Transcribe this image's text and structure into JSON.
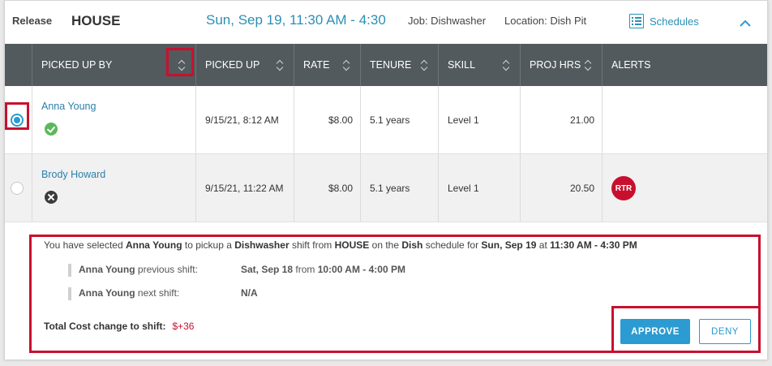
{
  "header": {
    "release_label": "Release",
    "location_name": "HOUSE",
    "date_range": "Sun, Sep 19, 11:30 AM - 4:30 PM",
    "job": "Job: Dishwasher",
    "location": "Location: Dish Pit",
    "schedules_label": "Schedules"
  },
  "table": {
    "columns": [
      "PICKED UP BY",
      "PICKED UP",
      "RATE",
      "TENURE",
      "SKILL",
      "PROJ HRS",
      "ALERTS"
    ],
    "rows": [
      {
        "name": "Anna Young",
        "status": "approved-check",
        "picked_up": "9/15/21, 8:12 AM",
        "rate": "$8.00",
        "tenure": "5.1 years",
        "skill": "Level 1",
        "proj_hrs": "21.00",
        "alert": "",
        "selected": true
      },
      {
        "name": "Brody Howard",
        "status": "rejected-x",
        "picked_up": "9/15/21, 11:22 AM",
        "rate": "$8.00",
        "tenure": "5.1 years",
        "skill": "Level 1",
        "proj_hrs": "20.50",
        "alert": "RTR",
        "selected": false
      }
    ]
  },
  "summary": {
    "sentence": {
      "p1": "You have selected ",
      "employee": "Anna Young",
      "p2": " to pickup a ",
      "job": "Dishwasher",
      "p3": " shift from ",
      "location": "HOUSE",
      "p4": " on the ",
      "schedule": "Dish",
      "p5": " schedule for ",
      "date": "Sun, Sep 19",
      "p6": " at ",
      "time": "11:30 AM - 4:30 PM"
    },
    "previous_shift": {
      "employee": "Anna Young",
      "label": " previous shift:",
      "day": "Sat, Sep 18",
      "from_word": " from ",
      "time": "10:00 AM - 4:00 PM"
    },
    "next_shift": {
      "employee": "Anna Young",
      "label": " next shift:",
      "value": "N/A"
    },
    "cost_label": "Total Cost change to shift:",
    "cost_value": "$+36"
  },
  "actions": {
    "approve": "APPROVE",
    "deny": "DENY"
  },
  "colors": {
    "accent": "#2b9bd1",
    "header_bar": "#535a5e",
    "highlight": "#c8102e",
    "alert_badge": "#c8102e",
    "success": "#5cb85c"
  }
}
